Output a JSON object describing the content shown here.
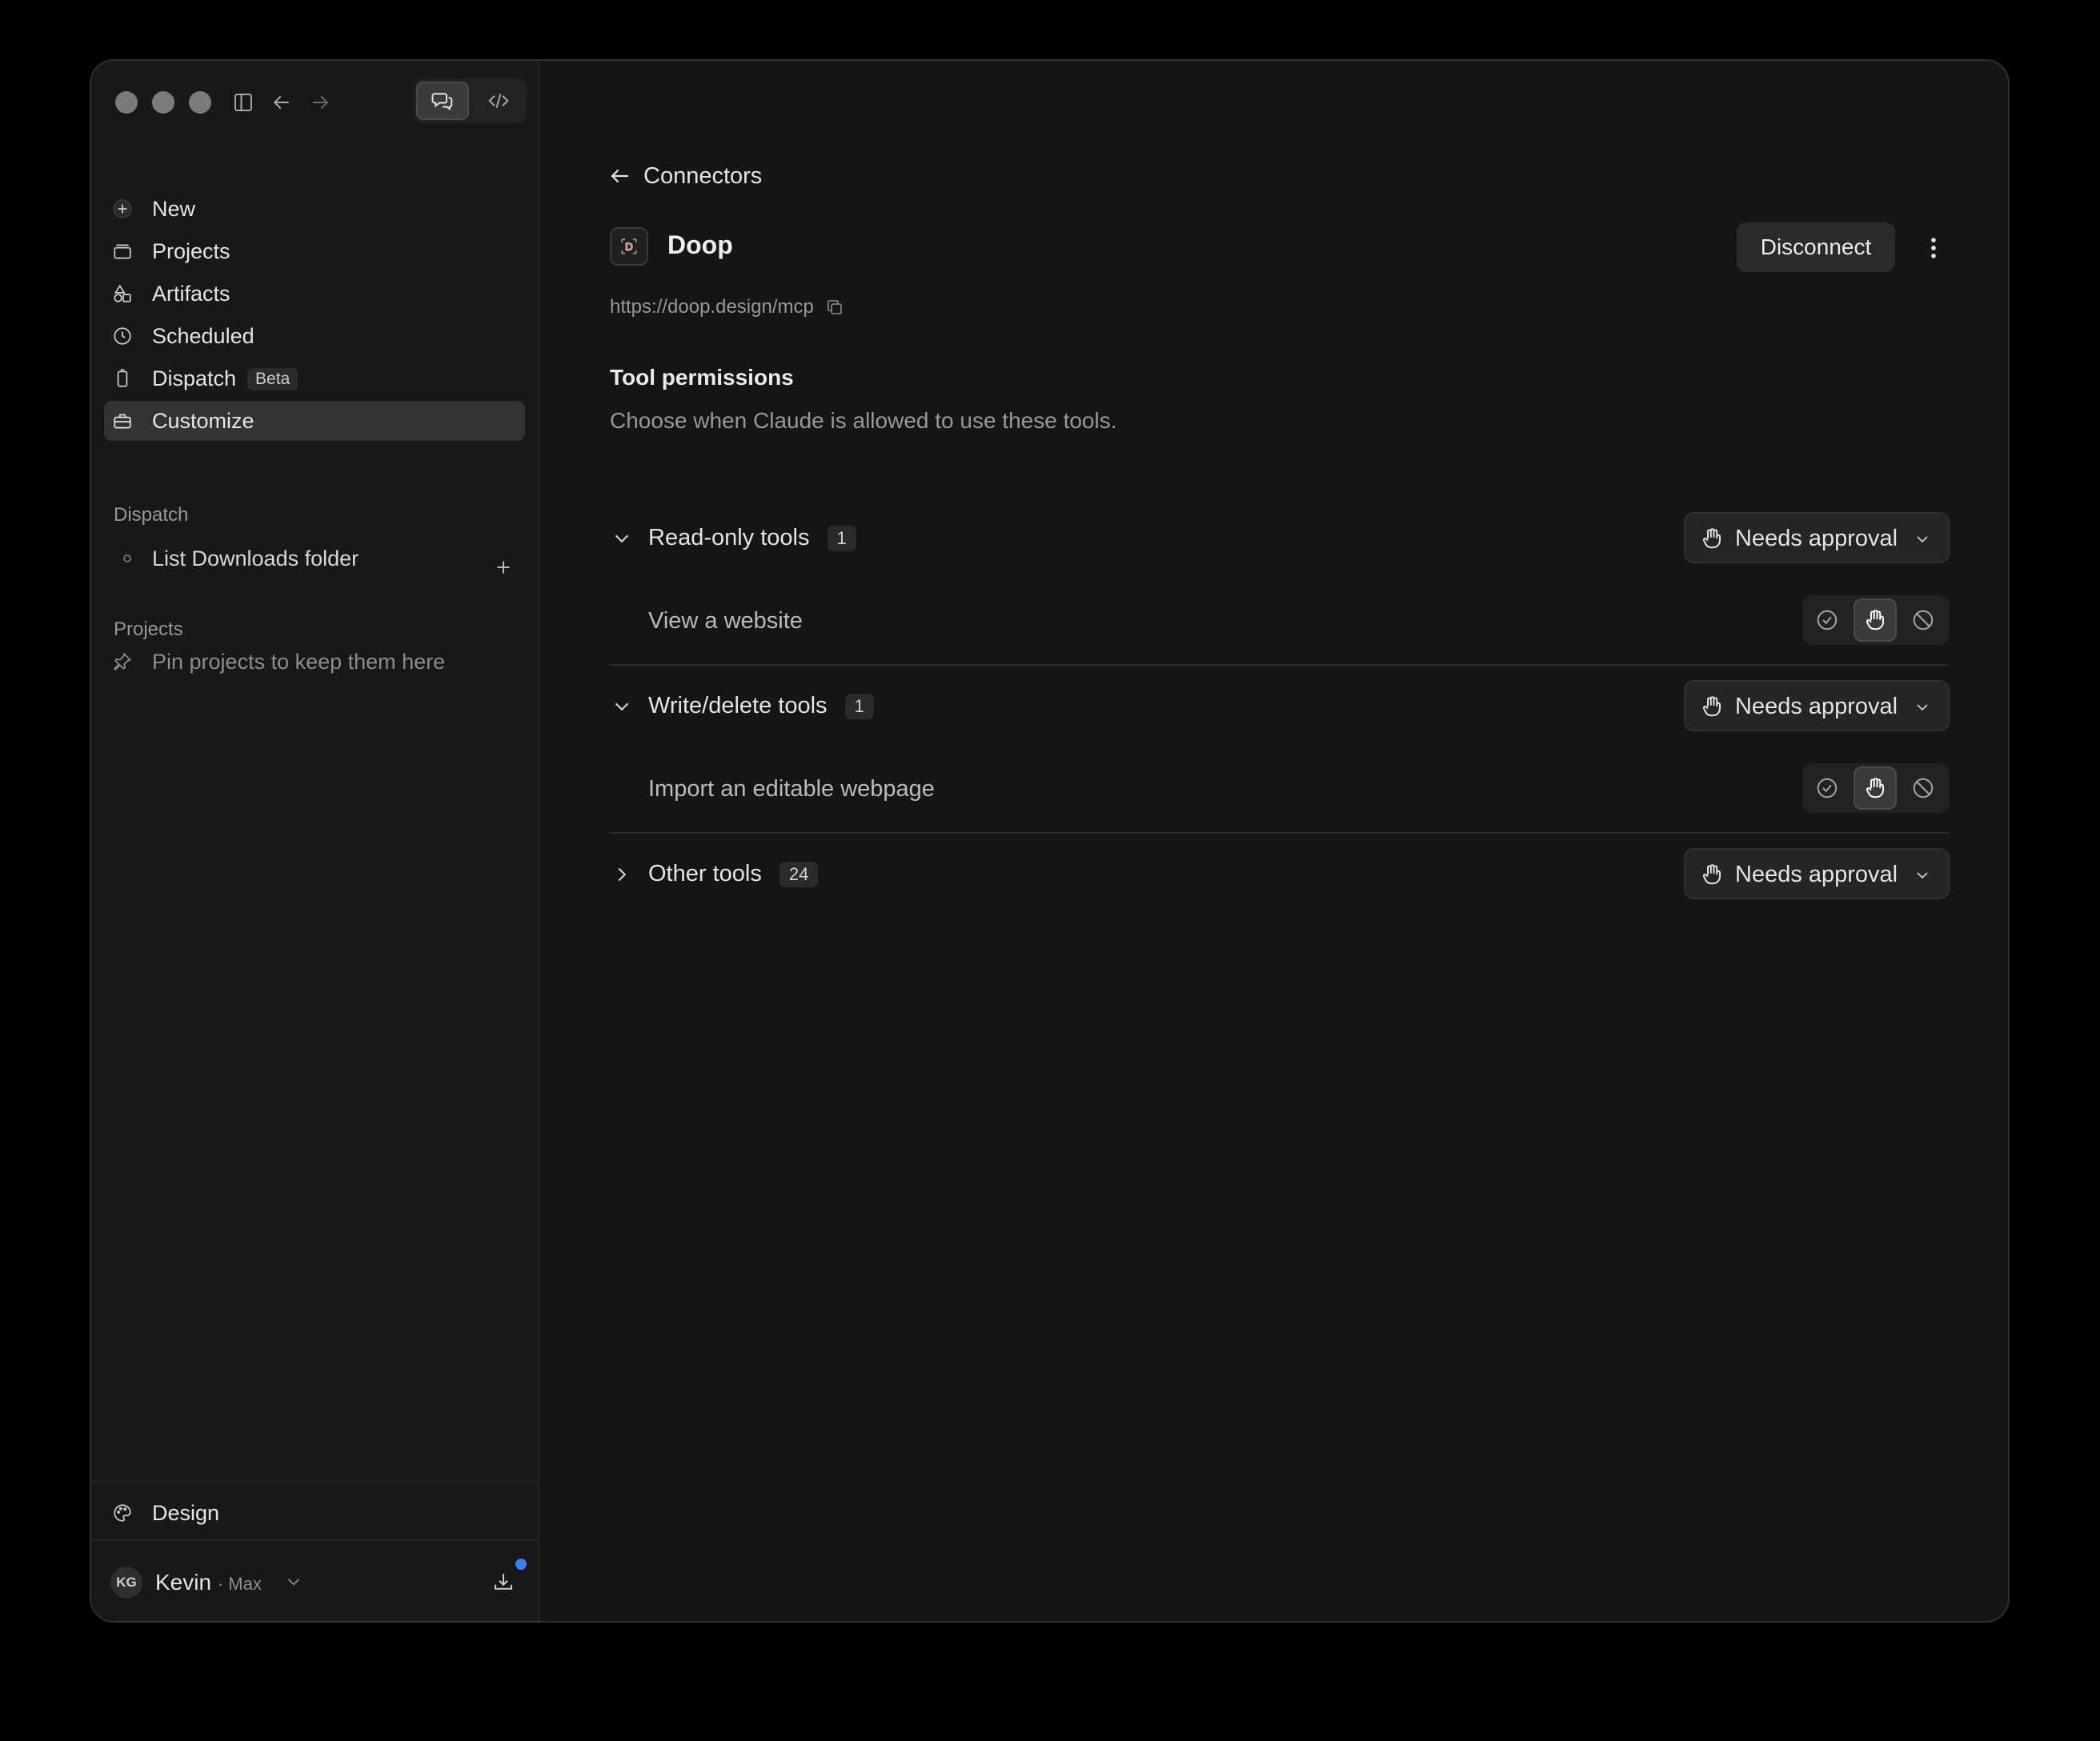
{
  "sidebar": {
    "nav": [
      {
        "label": "New",
        "icon": "plus-circle-icon"
      },
      {
        "label": "Projects",
        "icon": "folder-icon"
      },
      {
        "label": "Artifacts",
        "icon": "shapes-icon"
      },
      {
        "label": "Scheduled",
        "icon": "clock-icon"
      },
      {
        "label": "Dispatch",
        "icon": "phone-icon",
        "badge": "Beta"
      },
      {
        "label": "Customize",
        "icon": "briefcase-icon",
        "active": true
      }
    ],
    "dispatch_section": {
      "title": "Dispatch",
      "items": [
        "List Downloads folder"
      ]
    },
    "projects_section": {
      "title": "Projects",
      "empty_hint": "Pin projects to keep them here"
    },
    "design_label": "Design",
    "user": {
      "initials": "KG",
      "name": "Kevin",
      "plan": "· Max"
    }
  },
  "main": {
    "back_label": "Connectors",
    "connector": {
      "name": "Doop",
      "url": "https://doop.design/mcp",
      "logo_letter": "D"
    },
    "disconnect_label": "Disconnect",
    "permissions": {
      "title": "Tool permissions",
      "description": "Choose when Claude is allowed to use these tools.",
      "groups": [
        {
          "label": "Read-only tools",
          "count": "1",
          "mode": "Needs approval",
          "expanded": true,
          "tools": [
            "View a website"
          ]
        },
        {
          "label": "Write/delete tools",
          "count": "1",
          "mode": "Needs approval",
          "expanded": true,
          "tools": [
            "Import an editable webpage"
          ]
        },
        {
          "label": "Other tools",
          "count": "24",
          "mode": "Needs approval",
          "expanded": false,
          "tools": []
        }
      ]
    }
  },
  "colors": {
    "background": "#151515",
    "sidebar": "#181818",
    "accent_dot": "#3b7ff0",
    "logo_accent": "#e8705a"
  }
}
